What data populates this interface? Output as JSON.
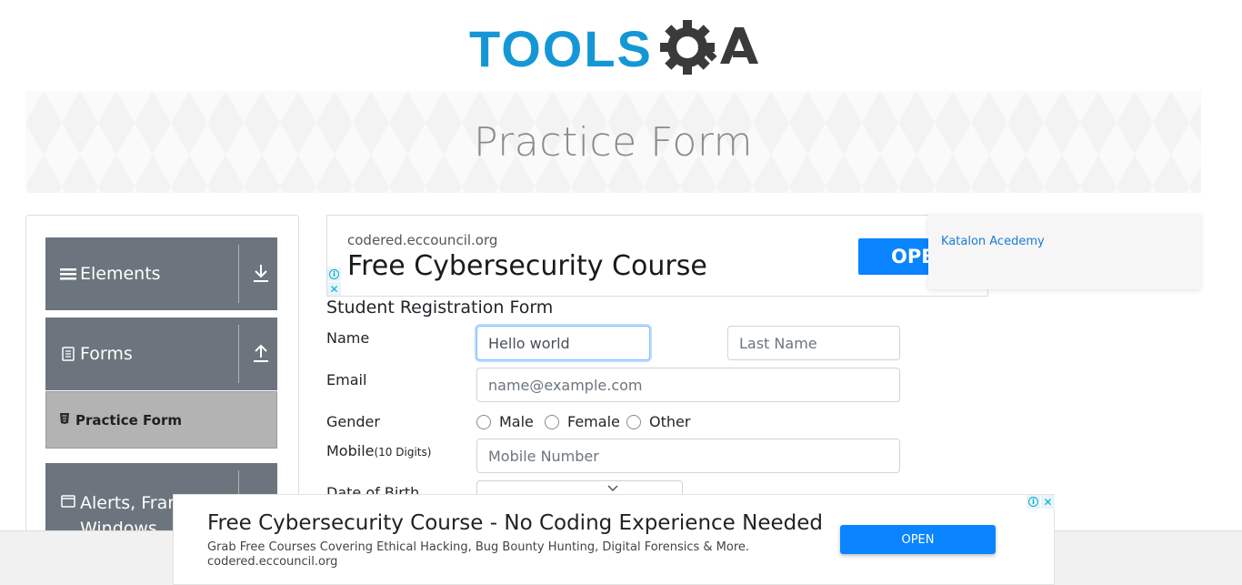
{
  "header": {
    "logo_text": "TOOLS",
    "logo_suffix": "QA"
  },
  "banner": {
    "title": "Practice Form"
  },
  "sidebar": {
    "groups": [
      {
        "title": "Elements",
        "icon": "hamburger-icon",
        "toggle": "download-icon"
      },
      {
        "title": "Forms",
        "icon": "document-icon",
        "toggle": "upload-icon"
      },
      {
        "title": "Alerts, Frame & Windows",
        "icon": "window-icon",
        "toggle": "download-icon"
      }
    ],
    "active_item": {
      "label": "Practice Form",
      "icon": "html5-icon"
    }
  },
  "top_ad": {
    "domain": "codered.eccouncil.org",
    "title": "Free Cybersecurity Course",
    "open_label": "OPE"
  },
  "right_card": {
    "link": "Katalon Acedemy"
  },
  "form": {
    "title": "Student Registration Form",
    "name_label": "Name",
    "first_name_value": "Hello world",
    "last_name_placeholder": "Last Name",
    "email_label": "Email",
    "email_placeholder": "name@example.com",
    "gender_label": "Gender",
    "gender_options": [
      "Male",
      "Female",
      "Other"
    ],
    "mobile_label": "Mobile",
    "mobile_hint": "(10 Digits)",
    "mobile_placeholder": "Mobile Number",
    "dob_label": "Date of Birth"
  },
  "bottom_ad": {
    "title": "Free Cybersecurity Course - No Coding Experience Needed",
    "description": "Grab Free Courses Covering Ethical Hacking, Bug Bounty Hunting, Digital Forensics & More.",
    "domain": "codered.eccouncil.org",
    "open_label": "OPEN"
  },
  "colors": {
    "brand_blue": "#1497d6",
    "brand_dark": "#3a3a3a",
    "sidebar_group": "#6c757d",
    "sidebar_active": "#b3b3b3",
    "ad_button": "#0a84ff"
  }
}
